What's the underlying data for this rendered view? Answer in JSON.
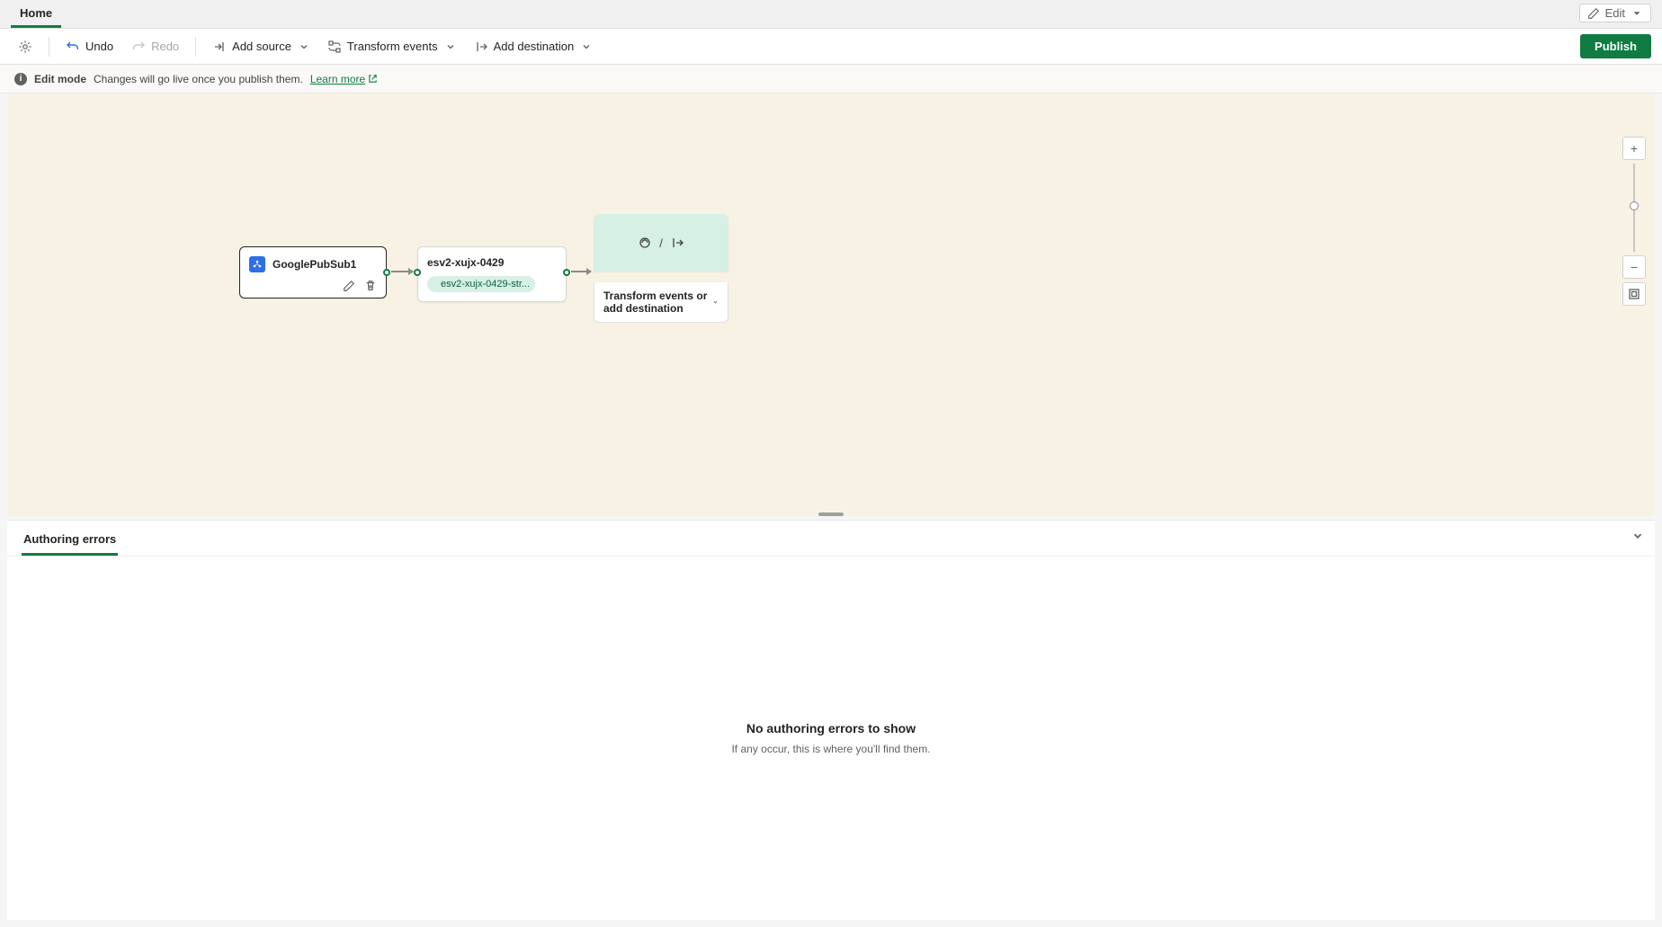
{
  "tabs": {
    "home": "Home"
  },
  "editMenu": {
    "label": "Edit"
  },
  "toolbar": {
    "undo": "Undo",
    "redo": "Redo",
    "addSource": "Add source",
    "transformEvents": "Transform events",
    "addDestination": "Add destination",
    "publish": "Publish"
  },
  "infoBar": {
    "mode": "Edit mode",
    "message": "Changes will go live once you publish them.",
    "learnMore": "Learn more"
  },
  "canvas": {
    "sourceNode": {
      "title": "GooglePubSub1"
    },
    "streamNode": {
      "title": "esv2-xujx-0429",
      "pill": "esv2-xujx-0429-str..."
    },
    "placeholder": {
      "action": "Transform events or add destination"
    }
  },
  "bottomPanel": {
    "tab": "Authoring errors",
    "emptyTitle": "No authoring errors to show",
    "emptySub": "If any occur, this is where you'll find them."
  }
}
